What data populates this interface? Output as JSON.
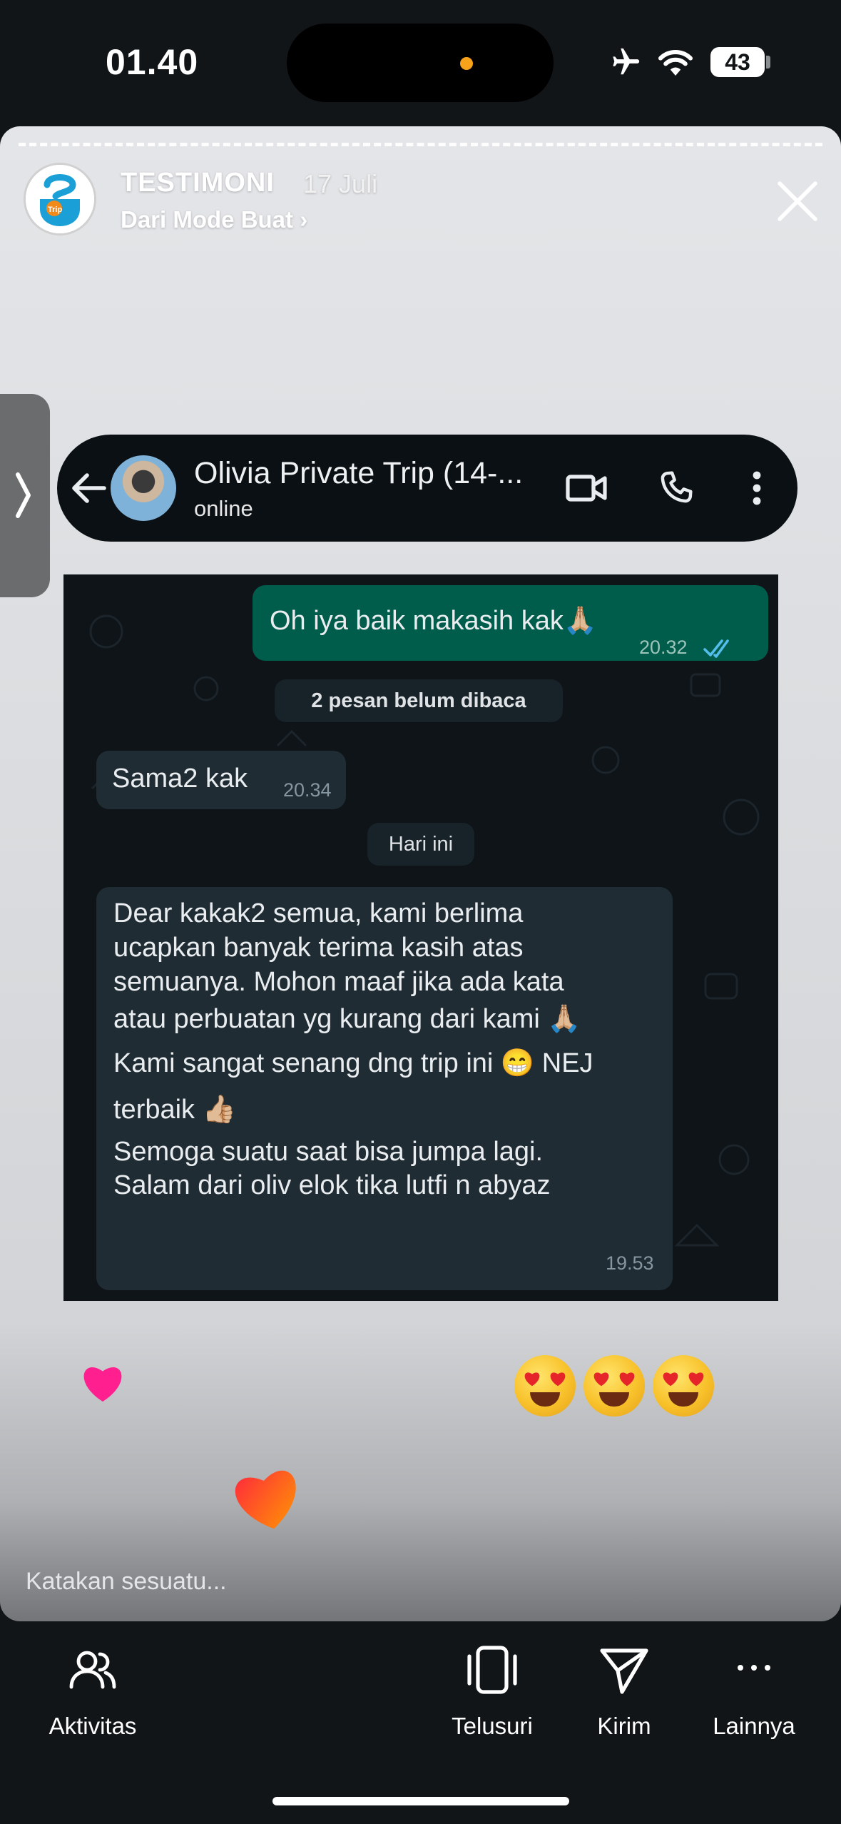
{
  "status_bar": {
    "time": "01.40",
    "battery": "43"
  },
  "story": {
    "account_name": "TESTIMONI",
    "date": "17 Juli",
    "subtitle": "Dari Mode Buat ›",
    "reply_placeholder": "Katakan sesuatu..."
  },
  "chat": {
    "contact_name": "Olivia Private Trip (14-...",
    "contact_status": "online",
    "messages": [
      {
        "type": "outgoing",
        "text": "Oh iya baik makasih kak🙏🏼",
        "time": "20.32"
      },
      {
        "type": "system",
        "text": "2 pesan belum dibaca"
      },
      {
        "type": "incoming",
        "text": "Sama2 kak",
        "time": "20.34"
      },
      {
        "type": "system",
        "text": "Hari ini"
      },
      {
        "type": "incoming",
        "lines": [
          "Dear kakak2 semua, kami berlima",
          "ucapkan banyak terima kasih atas",
          "semuanya. Mohon maaf jika ada kata",
          "atau perbuatan yg kurang dari kami  🙏🏼",
          "Kami sangat senang dng trip ini 😁 NEJ",
          "terbaik 👍🏼",
          "Semoga suatu saat bisa jumpa lagi.",
          "Salam dari oliv elok tika lutfi n abyaz"
        ],
        "time": "19.53"
      }
    ]
  },
  "bottom_nav": {
    "activity": "Aktivitas",
    "explore": "Telusuri",
    "send": "Kirim",
    "more": "Lainnya"
  },
  "colors": {
    "heart_pink": "#ff1f8e",
    "wa_outgoing": "#005c4b",
    "wa_incoming": "#1f2c34",
    "read_ticks": "#53bdeb"
  }
}
